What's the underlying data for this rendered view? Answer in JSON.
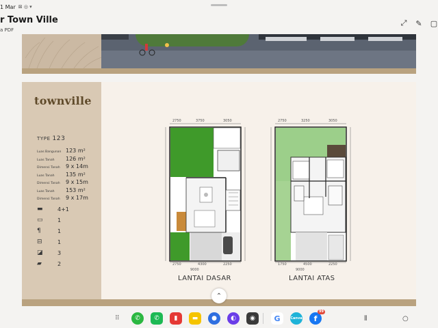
{
  "status": {
    "date": "1 Mar"
  },
  "header": {
    "title": "r Town Ville",
    "subtitle": "a PDF"
  },
  "sheet": {
    "logo": "townville",
    "type_label": "TYPE",
    "type_value": "123",
    "specs": [
      {
        "label": "Luas Bangunan",
        "value": "123 m²"
      },
      {
        "label": "Luas Tanah",
        "value": "126 m²"
      },
      {
        "label": "Dimensi Tanah",
        "value": "9 x 14m"
      },
      {
        "label": "Luas Tanah",
        "value": "135 m²"
      },
      {
        "label": "Dimensi Tanah",
        "value": "9 x 15m"
      },
      {
        "label": "Luas Tanah",
        "value": "153 m²"
      },
      {
        "label": "Dimensi Tanah",
        "value": "9 x 17m"
      }
    ],
    "amenities": [
      {
        "icon": "bed-icon",
        "value": "4+1"
      },
      {
        "icon": "sofa-icon",
        "value": "1"
      },
      {
        "icon": "dining-icon",
        "value": "1"
      },
      {
        "icon": "kitchen-icon",
        "value": "1"
      },
      {
        "icon": "bath-icon",
        "value": "3"
      },
      {
        "icon": "car-icon",
        "value": "2"
      }
    ],
    "plans": [
      {
        "label": "LANTAI DASAR",
        "top_dims": [
          "2750",
          "3750",
          "3050"
        ],
        "bottom_dims": [
          "2750",
          "4300",
          "2250"
        ],
        "total": "9000"
      },
      {
        "label": "LANTAI ATAS",
        "top_dims": [
          "2750",
          "3250",
          "3050"
        ],
        "bottom_dims": [
          "1750",
          "4500",
          "2250"
        ],
        "total": "9000"
      }
    ]
  },
  "dock": {
    "apps": [
      {
        "name": "whatsapp",
        "glyph": "✆",
        "color": "#2bb741"
      },
      {
        "name": "phone",
        "glyph": "✆",
        "color": "#1db954"
      },
      {
        "name": "notes",
        "glyph": "▮",
        "color": "#e53935"
      },
      {
        "name": "memo",
        "glyph": "▬",
        "color": "#f5c400"
      },
      {
        "name": "messages",
        "glyph": "●",
        "color": "#2f6fe0"
      },
      {
        "name": "internet",
        "glyph": "◐",
        "color": "#6a3de8"
      },
      {
        "name": "camera",
        "glyph": "◉",
        "color": "#3a3a3a"
      },
      {
        "name": "google",
        "glyph": "G",
        "color": "#ffffff"
      },
      {
        "name": "canva",
        "glyph": "Canva",
        "color": "#1fb3d8"
      },
      {
        "name": "facebook",
        "glyph": "f",
        "color": "#1877f2"
      }
    ],
    "facebook_badge": "99"
  },
  "colors": {
    "accent": "#b9a27f",
    "side": "#d9c9b4",
    "logo": "#5f4a2a"
  }
}
